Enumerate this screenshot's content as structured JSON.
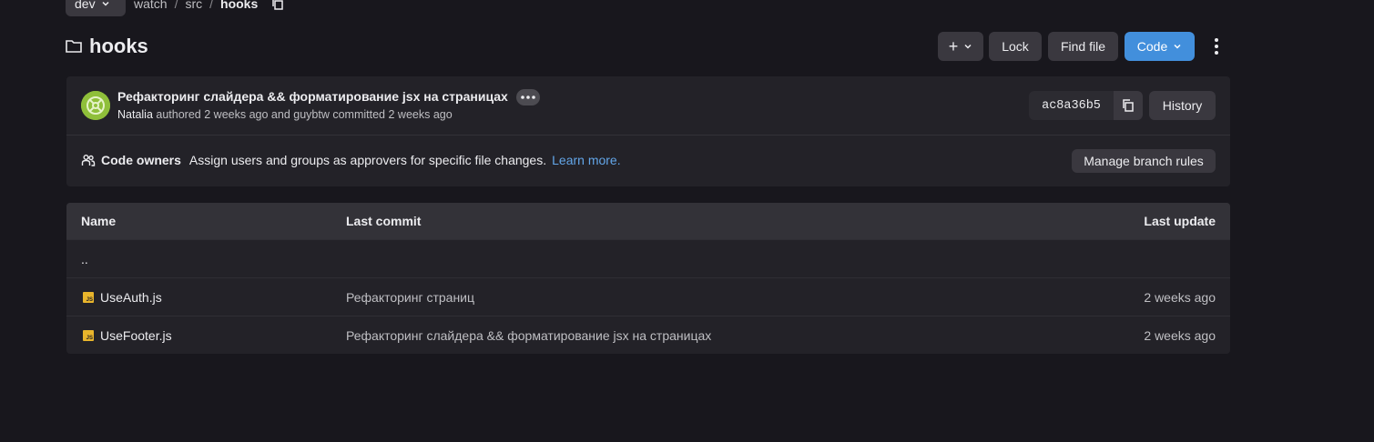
{
  "breadcrumb": {
    "branch": "dev",
    "parts": [
      "watch",
      "src",
      "hooks"
    ],
    "separator": "/"
  },
  "page": {
    "title": "hooks"
  },
  "actions": {
    "add_label": "+",
    "lock_label": "Lock",
    "find_file_label": "Find file",
    "code_label": "Code"
  },
  "commit": {
    "title": "Рефакторинг слайдера && форматирование jsx на страницах",
    "author": "Natalia",
    "authored_text": "authored",
    "authored_time": "2 weeks ago",
    "and_text": "and",
    "committer": "guybtw",
    "committed_text": "committed",
    "committed_time": "2 weeks ago",
    "sha": "ac8a36b5",
    "history_label": "History"
  },
  "code_owners": {
    "label": "Code owners",
    "description": "Assign users and groups as approvers for specific file changes.",
    "link": "Learn more.",
    "manage_label": "Manage branch rules"
  },
  "table": {
    "headers": {
      "name": "Name",
      "last_commit": "Last commit",
      "last_update": "Last update"
    },
    "parent": "..",
    "rows": [
      {
        "name": "UseAuth.js",
        "commit": "Рефакторинг страниц",
        "updated": "2 weeks ago"
      },
      {
        "name": "UseFooter.js",
        "commit": "Рефакторинг слайдера && форматирование jsx на страницах",
        "updated": "2 weeks ago"
      }
    ]
  },
  "colors": {
    "background": "#18171d",
    "card": "#232228",
    "button": "#3a383f",
    "accent": "#428fdc",
    "link": "#63a6e9",
    "js_icon": "#e9b52c"
  }
}
